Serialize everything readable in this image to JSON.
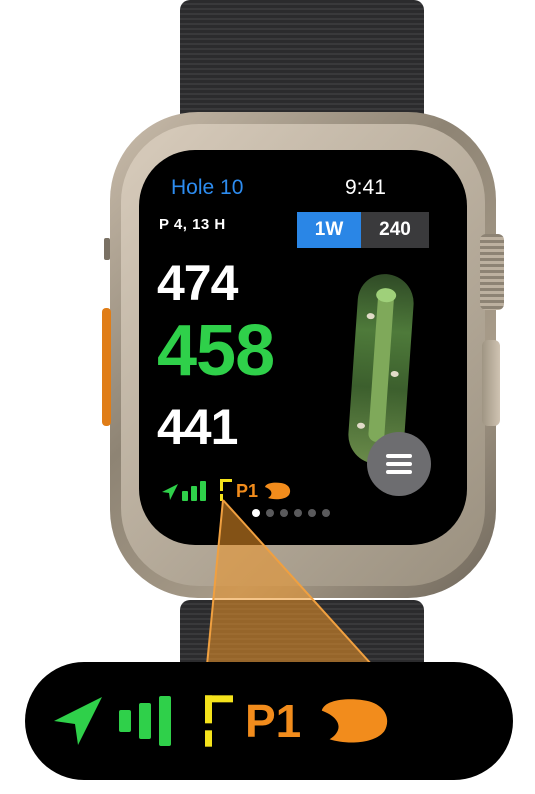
{
  "header": {
    "hole_title": "Hole 10",
    "time": "9:41"
  },
  "hole_info": {
    "par_handicap": "P 4, 13 H"
  },
  "club_selector": {
    "club": "1W",
    "distance": "240"
  },
  "distances": {
    "back": "474",
    "center": "458",
    "front": "441"
  },
  "status": {
    "gps_signal_bars": 3,
    "pin_position": "P1",
    "signal_color": "#2fd04a",
    "pin_color": "#f28c1c",
    "flag_color": "#f5e31c"
  },
  "pagination": {
    "page_count": 6,
    "active_page": 1
  },
  "callout": {
    "pin_position": "P1"
  },
  "icons": [
    "gps-arrow-icon",
    "signal-bars-icon",
    "flag-icon",
    "green-shape-icon",
    "menu-icon"
  ]
}
